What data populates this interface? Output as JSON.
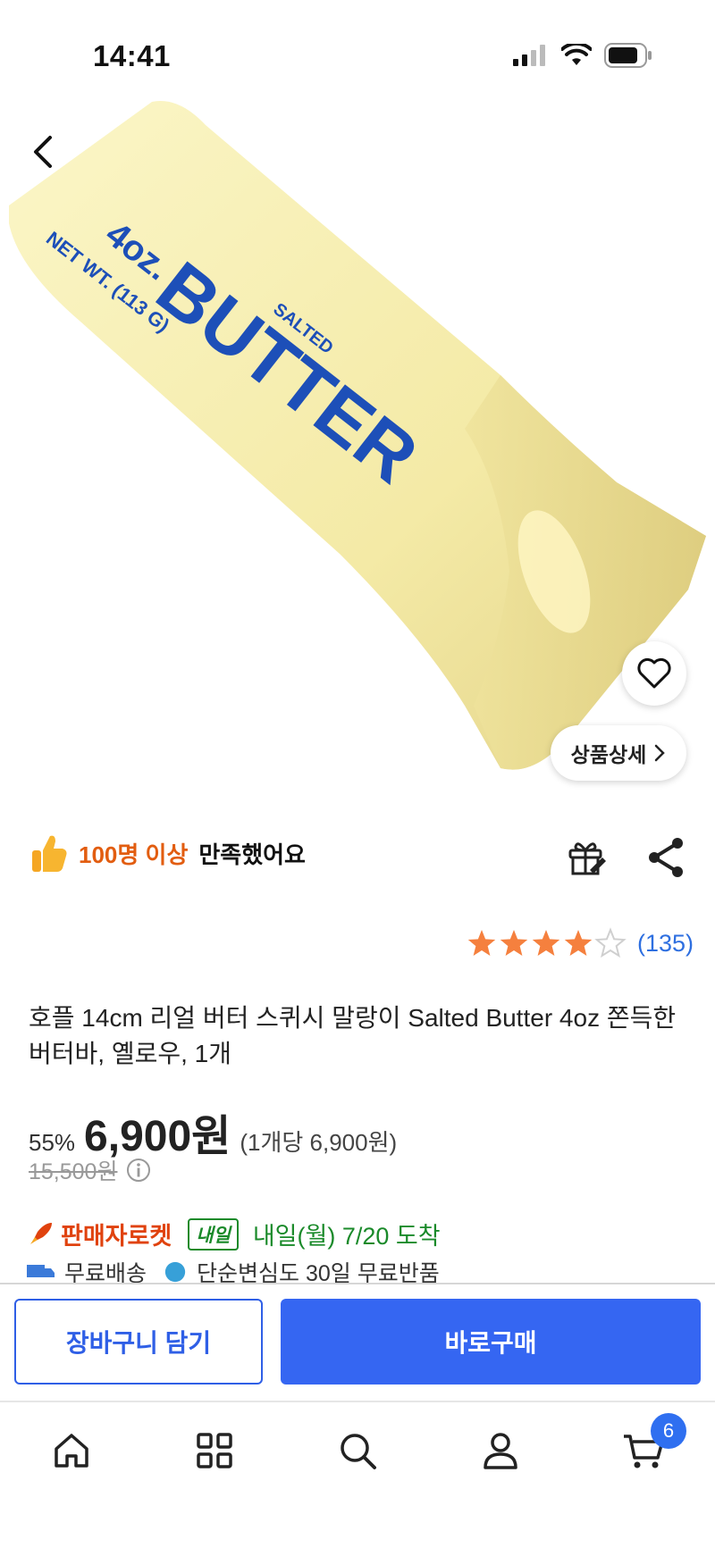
{
  "status_bar": {
    "time": "14:41"
  },
  "product_image": {
    "net_wt": "NET WT. (113 G)",
    "size": "4oz.",
    "salted": "SALTED",
    "brand": "BUTTER"
  },
  "image_overlay": {
    "detail_label": "상품상세"
  },
  "satisfaction": {
    "highlight": "100명 이상",
    "text": "만족했어요"
  },
  "rating": {
    "stars": 4,
    "max": 5,
    "count": "(135)"
  },
  "product": {
    "title": "호플 14cm 리얼 버터 스퀴시 말랑이 Salted Butter 4oz 쫀득한 버터바, 옐로우, 1개"
  },
  "price": {
    "discount": "55%",
    "sale": "6,900원",
    "unit": "(1개당 6,900원)",
    "original": "15,500원"
  },
  "delivery": {
    "seller_rocket": "판매자로켓",
    "badge": "내일",
    "arrival": "내일(월) 7/20 도착",
    "free_shipping": "무료배송",
    "free_return": "단순변심도 30일 무료반품"
  },
  "actions": {
    "add_to_cart": "장바구니 담기",
    "buy_now": "바로구매"
  },
  "tab_bar": {
    "cart_count": "6"
  },
  "colors": {
    "accent": "#3566f2",
    "orange": "#e25d10",
    "green": "#1a8a2a",
    "star": "#f5803e"
  }
}
